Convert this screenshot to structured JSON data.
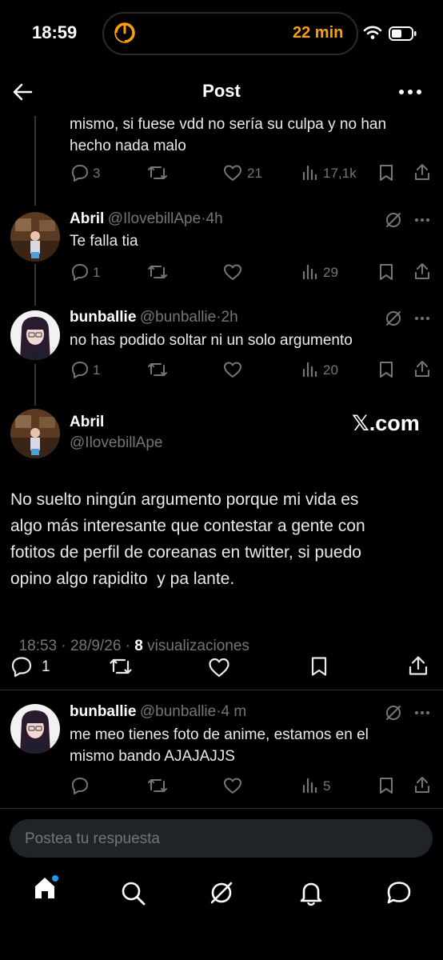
{
  "status": {
    "time": "18:59",
    "timer": "22 min"
  },
  "header": {
    "title": "Post"
  },
  "tweets": [
    {
      "text": "mismo, si fuese vdd no sería su culpa y no han hecho nada malo",
      "replies": "3",
      "views": "17,1k",
      "likes": "21"
    },
    {
      "name": "Abril",
      "handle": "@IlovebillApe",
      "time": "4h",
      "text": "Te falla tia",
      "replies": "1",
      "views": "29"
    },
    {
      "name": "bunballie",
      "handle": "@bunballie",
      "time": "2h",
      "text": "no has podido soltar ni un solo argumento",
      "replies": "1",
      "views": "20"
    }
  ],
  "main": {
    "name": "Abril",
    "handle": "@IlovebillApe",
    "watermark": "𝕏.com",
    "text_lines": [
      "No suelto ningún argumento porque mi vida es",
      "algo más interesante que contestar a gente con",
      "fotitos de perfil de coreanas en twitter, si puedo",
      "opino algo rapidito  y pa lante."
    ],
    "meta_time": "18:53 · 28/9/26 · ",
    "meta_views": "8",
    "meta_views_label": " visualizaciones",
    "replies": "1"
  },
  "reply": {
    "name": "bunballie",
    "handle": "@bunballie",
    "time": "4 m",
    "text_lines": [
      "me meo tienes foto de anime, estamos en el",
      "mismo bando AJAJAJJS"
    ],
    "views": "5"
  },
  "composer": {
    "placeholder": "Postea tu respuesta"
  },
  "colors": {
    "background": "#000000",
    "text": "#e7e9ea",
    "muted": "#71767b",
    "accent": "#1d9bf0",
    "timer": "#ff9f0a"
  }
}
